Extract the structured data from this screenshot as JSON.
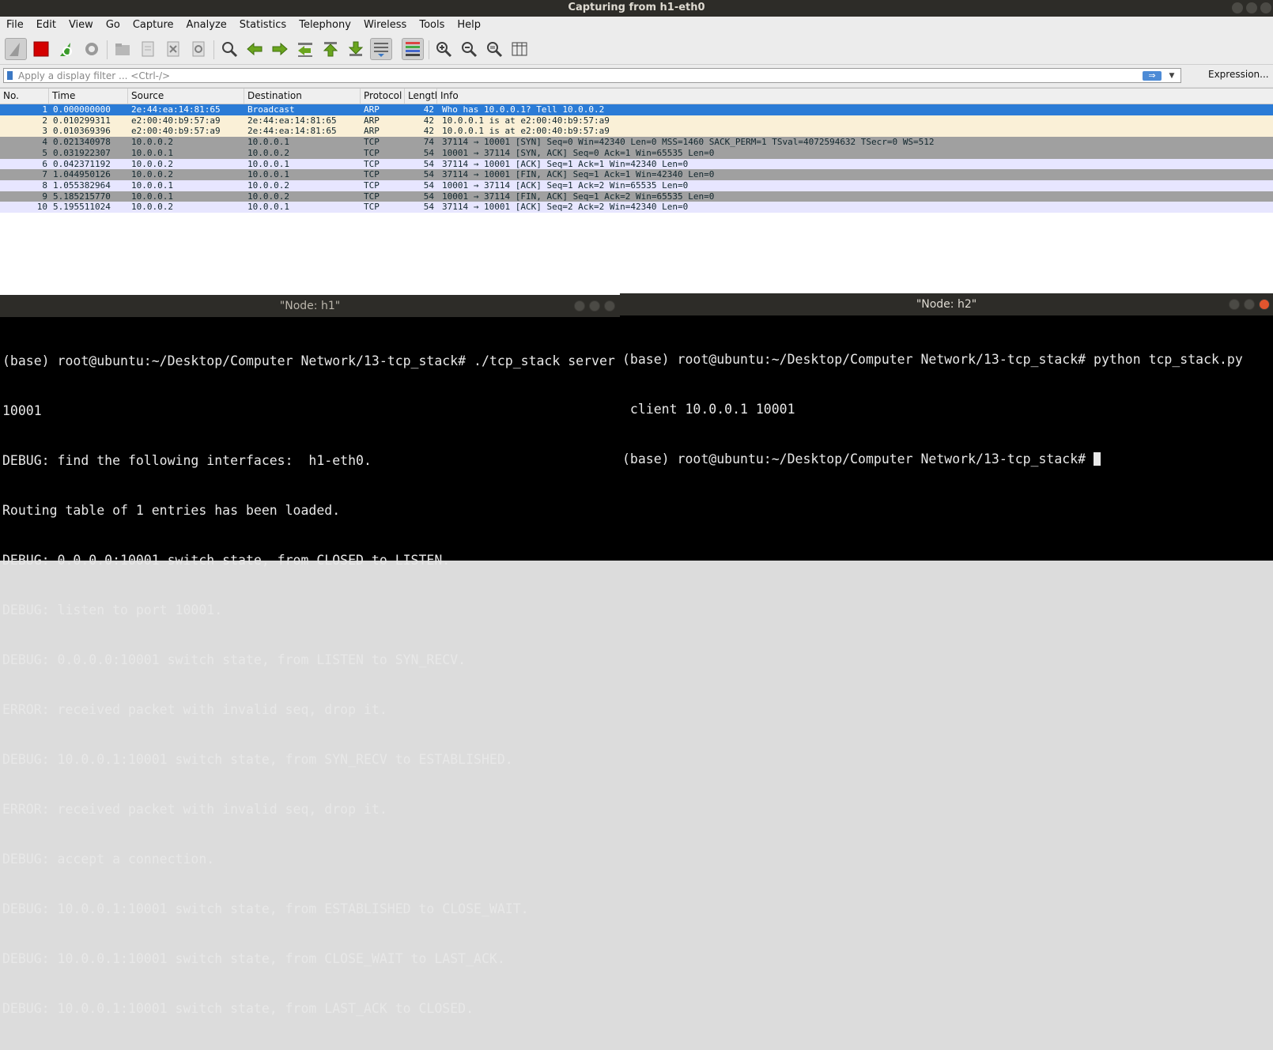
{
  "window": {
    "title": "Capturing from h1-eth0"
  },
  "menu": [
    "File",
    "Edit",
    "View",
    "Go",
    "Capture",
    "Analyze",
    "Statistics",
    "Telephony",
    "Wireless",
    "Tools",
    "Help"
  ],
  "filter": {
    "placeholder": "Apply a display filter ... <Ctrl-/>",
    "expression_label": "Expression..."
  },
  "packet_list": {
    "columns": [
      "No.",
      "Time",
      "Source",
      "Destination",
      "Protocol",
      "Length",
      "Info"
    ],
    "rows": [
      {
        "no": "1",
        "time": "0.000000000",
        "src": "2e:44:ea:14:81:65",
        "dst": "Broadcast",
        "proto": "ARP",
        "len": "42",
        "info": "Who has 10.0.0.1? Tell 10.0.0.2",
        "bg": "#2a7bd6",
        "fg": "#ffffff"
      },
      {
        "no": "2",
        "time": "0.010299311",
        "src": "e2:00:40:b9:57:a9",
        "dst": "2e:44:ea:14:81:65",
        "proto": "ARP",
        "len": "42",
        "info": "10.0.0.1 is at e2:00:40:b9:57:a9",
        "bg": "#faf0d7",
        "fg": "#12272e"
      },
      {
        "no": "3",
        "time": "0.010369396",
        "src": "e2:00:40:b9:57:a9",
        "dst": "2e:44:ea:14:81:65",
        "proto": "ARP",
        "len": "42",
        "info": "10.0.0.1 is at e2:00:40:b9:57:a9",
        "bg": "#faf0d7",
        "fg": "#12272e"
      },
      {
        "no": "4",
        "time": "0.021340978",
        "src": "10.0.0.2",
        "dst": "10.0.0.1",
        "proto": "TCP",
        "len": "74",
        "info": "37114 → 10001 [SYN] Seq=0 Win=42340 Len=0 MSS=1460 SACK_PERM=1 TSval=4072594632 TSecr=0 WS=512",
        "bg": "#a0a0a0",
        "fg": "#12272e"
      },
      {
        "no": "5",
        "time": "0.031922307",
        "src": "10.0.0.1",
        "dst": "10.0.0.2",
        "proto": "TCP",
        "len": "54",
        "info": "10001 → 37114 [SYN, ACK] Seq=0 Ack=1 Win=65535 Len=0",
        "bg": "#a0a0a0",
        "fg": "#12272e"
      },
      {
        "no": "6",
        "time": "0.042371192",
        "src": "10.0.0.2",
        "dst": "10.0.0.1",
        "proto": "TCP",
        "len": "54",
        "info": "37114 → 10001 [ACK] Seq=1 Ack=1 Win=42340 Len=0",
        "bg": "#e7e6ff",
        "fg": "#12272e"
      },
      {
        "no": "7",
        "time": "1.044950126",
        "src": "10.0.0.2",
        "dst": "10.0.0.1",
        "proto": "TCP",
        "len": "54",
        "info": "37114 → 10001 [FIN, ACK] Seq=1 Ack=1 Win=42340 Len=0",
        "bg": "#a0a0a0",
        "fg": "#12272e"
      },
      {
        "no": "8",
        "time": "1.055382964",
        "src": "10.0.0.1",
        "dst": "10.0.0.2",
        "proto": "TCP",
        "len": "54",
        "info": "10001 → 37114 [ACK] Seq=1 Ack=2 Win=65535 Len=0",
        "bg": "#e7e6ff",
        "fg": "#12272e"
      },
      {
        "no": "9",
        "time": "5.185215770",
        "src": "10.0.0.1",
        "dst": "10.0.0.2",
        "proto": "TCP",
        "len": "54",
        "info": "10001 → 37114 [FIN, ACK] Seq=1 Ack=2 Win=65535 Len=0",
        "bg": "#a0a0a0",
        "fg": "#12272e"
      },
      {
        "no": "10",
        "time": "5.195511024",
        "src": "10.0.0.2",
        "dst": "10.0.0.1",
        "proto": "TCP",
        "len": "54",
        "info": "37114 → 10001 [ACK] Seq=2 Ack=2 Win=42340 Len=0",
        "bg": "#e7e6ff",
        "fg": "#12272e"
      }
    ]
  },
  "terminal_h1": {
    "title": "\"Node: h1\"",
    "lines": [
      "(base) root@ubuntu:~/Desktop/Computer Network/13-tcp_stack# ./tcp_stack server",
      "10001",
      "DEBUG: find the following interfaces:  h1-eth0.",
      "Routing table of 1 entries has been loaded.",
      "DEBUG: 0.0.0.0:10001 switch state, from CLOSED to LISTEN.",
      "DEBUG: listen to port 10001.",
      "DEBUG: 0.0.0.0:10001 switch state, from LISTEN to SYN_RECV.",
      "ERROR: received packet with invalid seq, drop it.",
      "DEBUG: 10.0.0.1:10001 switch state, from SYN_RECV to ESTABLISHED.",
      "ERROR: received packet with invalid seq, drop it.",
      "DEBUG: accept a connection.",
      "DEBUG: 10.0.0.1:10001 switch state, from ESTABLISHED to CLOSE_WAIT.",
      "DEBUG: 10.0.0.1:10001 switch state, from CLOSE_WAIT to LAST_ACK.",
      "DEBUG: 10.0.0.1:10001 switch state, from LAST_ACK to CLOSED."
    ]
  },
  "terminal_h2": {
    "title": "\"Node: h2\"",
    "lines": [
      "(base) root@ubuntu:~/Desktop/Computer Network/13-tcp_stack# python tcp_stack.py",
      " client 10.0.0.1 10001",
      "(base) root@ubuntu:~/Desktop/Computer Network/13-tcp_stack# "
    ]
  }
}
